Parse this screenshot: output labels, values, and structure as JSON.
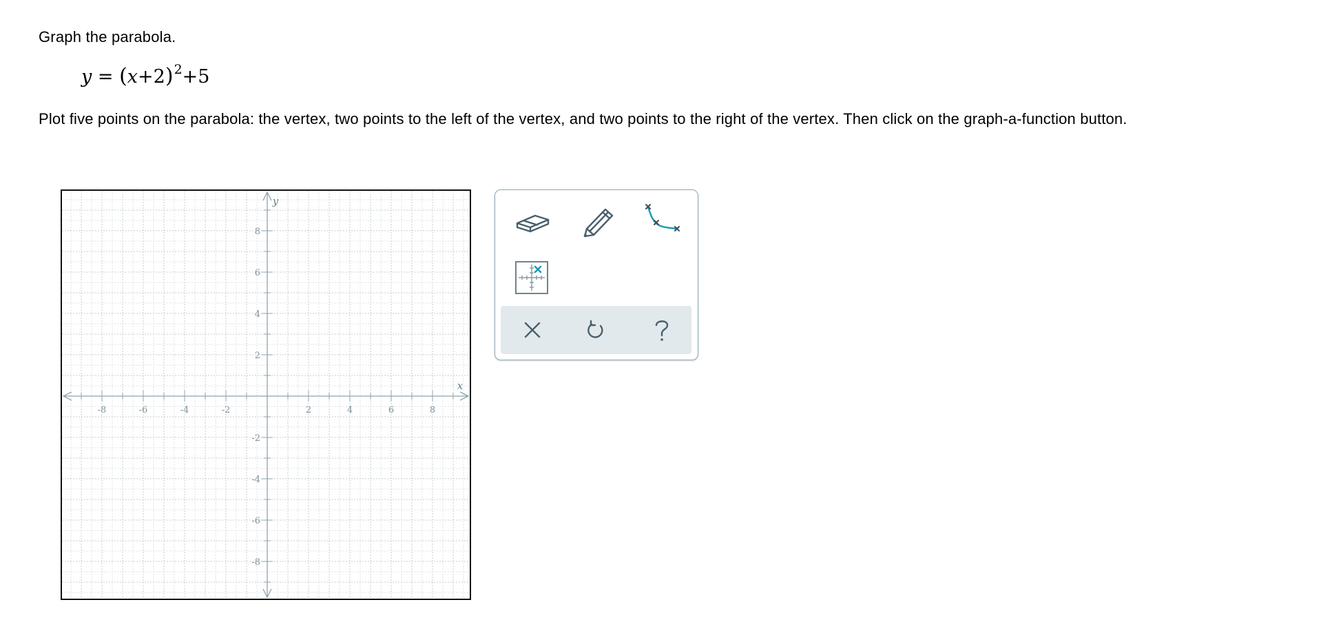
{
  "question": {
    "title": "Graph the parabola.",
    "equation": {
      "lhs": "y",
      "equals": "=",
      "open_paren": "(",
      "x": "x",
      "plus_1": "+",
      "two": "2",
      "close_paren": ")",
      "exponent": "2",
      "plus_2": "+",
      "five": "5"
    },
    "instructions": "Plot five points on the parabola: the vertex, two points to the left of the vertex, and two points to the right of the vertex. Then click on the graph-a-function button."
  },
  "graph": {
    "x_axis_label": "x",
    "y_axis_label": "y",
    "x_range": [
      -10,
      10
    ],
    "y_range": [
      -10,
      10
    ],
    "grid": true,
    "x_tick_labels": [
      "-8",
      "-6",
      "-4",
      "-2",
      "2",
      "4",
      "6",
      "8"
    ],
    "y_tick_labels": [
      "8",
      "6",
      "4",
      "2",
      "-2",
      "-4",
      "-6",
      "-8"
    ]
  },
  "toolbar": {
    "tools": [
      {
        "name": "eraser-tool",
        "icon": "eraser-icon"
      },
      {
        "name": "pencil-tool",
        "icon": "pencil-icon"
      },
      {
        "name": "graph-function-tool",
        "icon": "curve-through-points-icon"
      },
      {
        "name": "point-grid-tool",
        "icon": "grid-point-icon"
      }
    ],
    "actions": [
      {
        "name": "clear-button",
        "icon": "close-icon"
      },
      {
        "name": "undo-button",
        "icon": "undo-icon"
      },
      {
        "name": "help-button",
        "icon": "question-icon"
      }
    ],
    "colors": {
      "icon": "#4a5f6b",
      "accent": "#1a9bb0",
      "border": "#8fa9b6",
      "action_bar": "#e1e9ec"
    }
  }
}
